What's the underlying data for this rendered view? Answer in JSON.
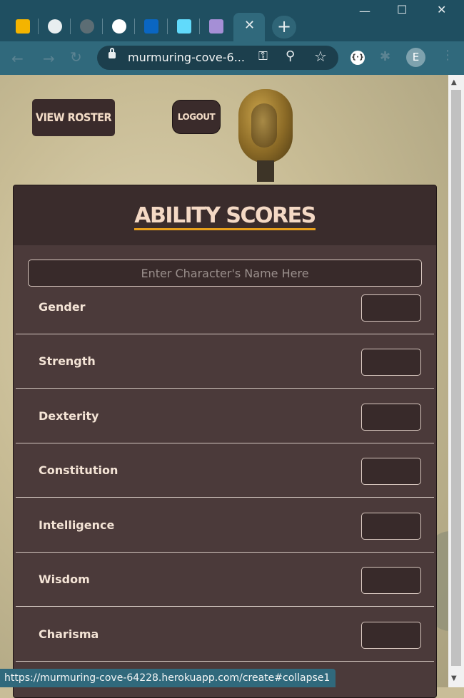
{
  "browser": {
    "url_display": "murmuring-cove-6...",
    "status_url": "https://murmuring-cove-64228.herokuapp.com/create#collapse1",
    "profile_initial": "E",
    "active_tab_close": "✕",
    "new_tab": "+",
    "tabs": [
      {
        "icon": "slides-icon",
        "color": "#f4b400"
      },
      {
        "icon": "github-icon",
        "color": "#e8eef0"
      },
      {
        "icon": "globe-icon",
        "color": "#5c6d74"
      },
      {
        "icon": "cs-icon",
        "color": "#ffffff"
      },
      {
        "icon": "linkedin-icon",
        "color": "#0a66c2"
      },
      {
        "icon": "react-icon",
        "color": "#61dafb"
      },
      {
        "icon": "heroku-icon",
        "color": "#a58fd6"
      }
    ]
  },
  "nav": {
    "view_roster": "VIEW ROSTER",
    "logout": "LOGOUT"
  },
  "form": {
    "title": "ABILITY SCORES",
    "name_placeholder": "Enter Character's Name Here",
    "fields": [
      "Gender",
      "Strength",
      "Dexterity",
      "Constitution",
      "Intelligence",
      "Wisdom",
      "Charisma"
    ]
  },
  "colors": {
    "accent_underline": "#e8a01c",
    "card": "#4b3a3a",
    "chrome": "#30697c"
  }
}
